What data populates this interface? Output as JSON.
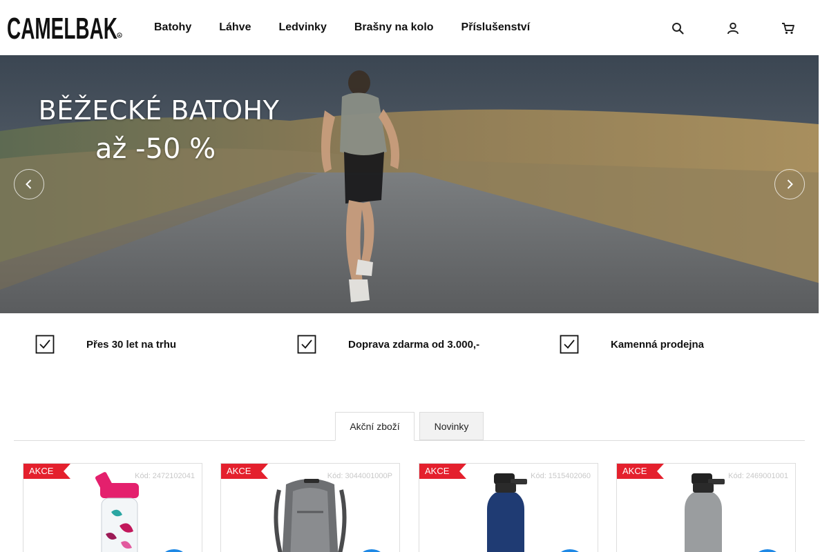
{
  "brand": {
    "logo_text": "CAMELBAK"
  },
  "nav": {
    "items": [
      "Batohy",
      "Láhve",
      "Ledvinky",
      "Brašny na kolo",
      "Příslušenství"
    ]
  },
  "header_icons": [
    "search-icon",
    "user-icon",
    "cart-icon"
  ],
  "hero": {
    "title": "BĚŽECKÉ BATOHY",
    "subtitle": "až -50 %",
    "prev_icon": "chevron-left-icon",
    "next_icon": "chevron-right-icon"
  },
  "usps": [
    {
      "icon": "check-square-icon",
      "text": "Přes 30 let na trhu"
    },
    {
      "icon": "check-square-icon",
      "text": "Doprava zdarma od 3.000,-"
    },
    {
      "icon": "check-square-icon",
      "text": "Kamenná prodejna"
    }
  ],
  "tabs": [
    {
      "label": "Akční zboží",
      "active": true
    },
    {
      "label": "Novinky",
      "active": false
    }
  ],
  "products": [
    {
      "badge": "AKCE",
      "code": "Kód: 2472102041",
      "image": "kids-bottle-butterflies"
    },
    {
      "badge": "AKCE",
      "code": "Kód: 3044001000P",
      "image": "grey-hydration-backpack"
    },
    {
      "badge": "AKCE",
      "code": "Kód: 1515402060",
      "image": "navy-insulated-bottle"
    },
    {
      "badge": "AKCE",
      "code": "Kód: 2469001001",
      "image": "grey-clear-bottle"
    }
  ],
  "colors": {
    "badge_red": "#e4202d",
    "cart_blue": "#1e88e5",
    "text": "#111111",
    "border": "#dcdcdc"
  }
}
